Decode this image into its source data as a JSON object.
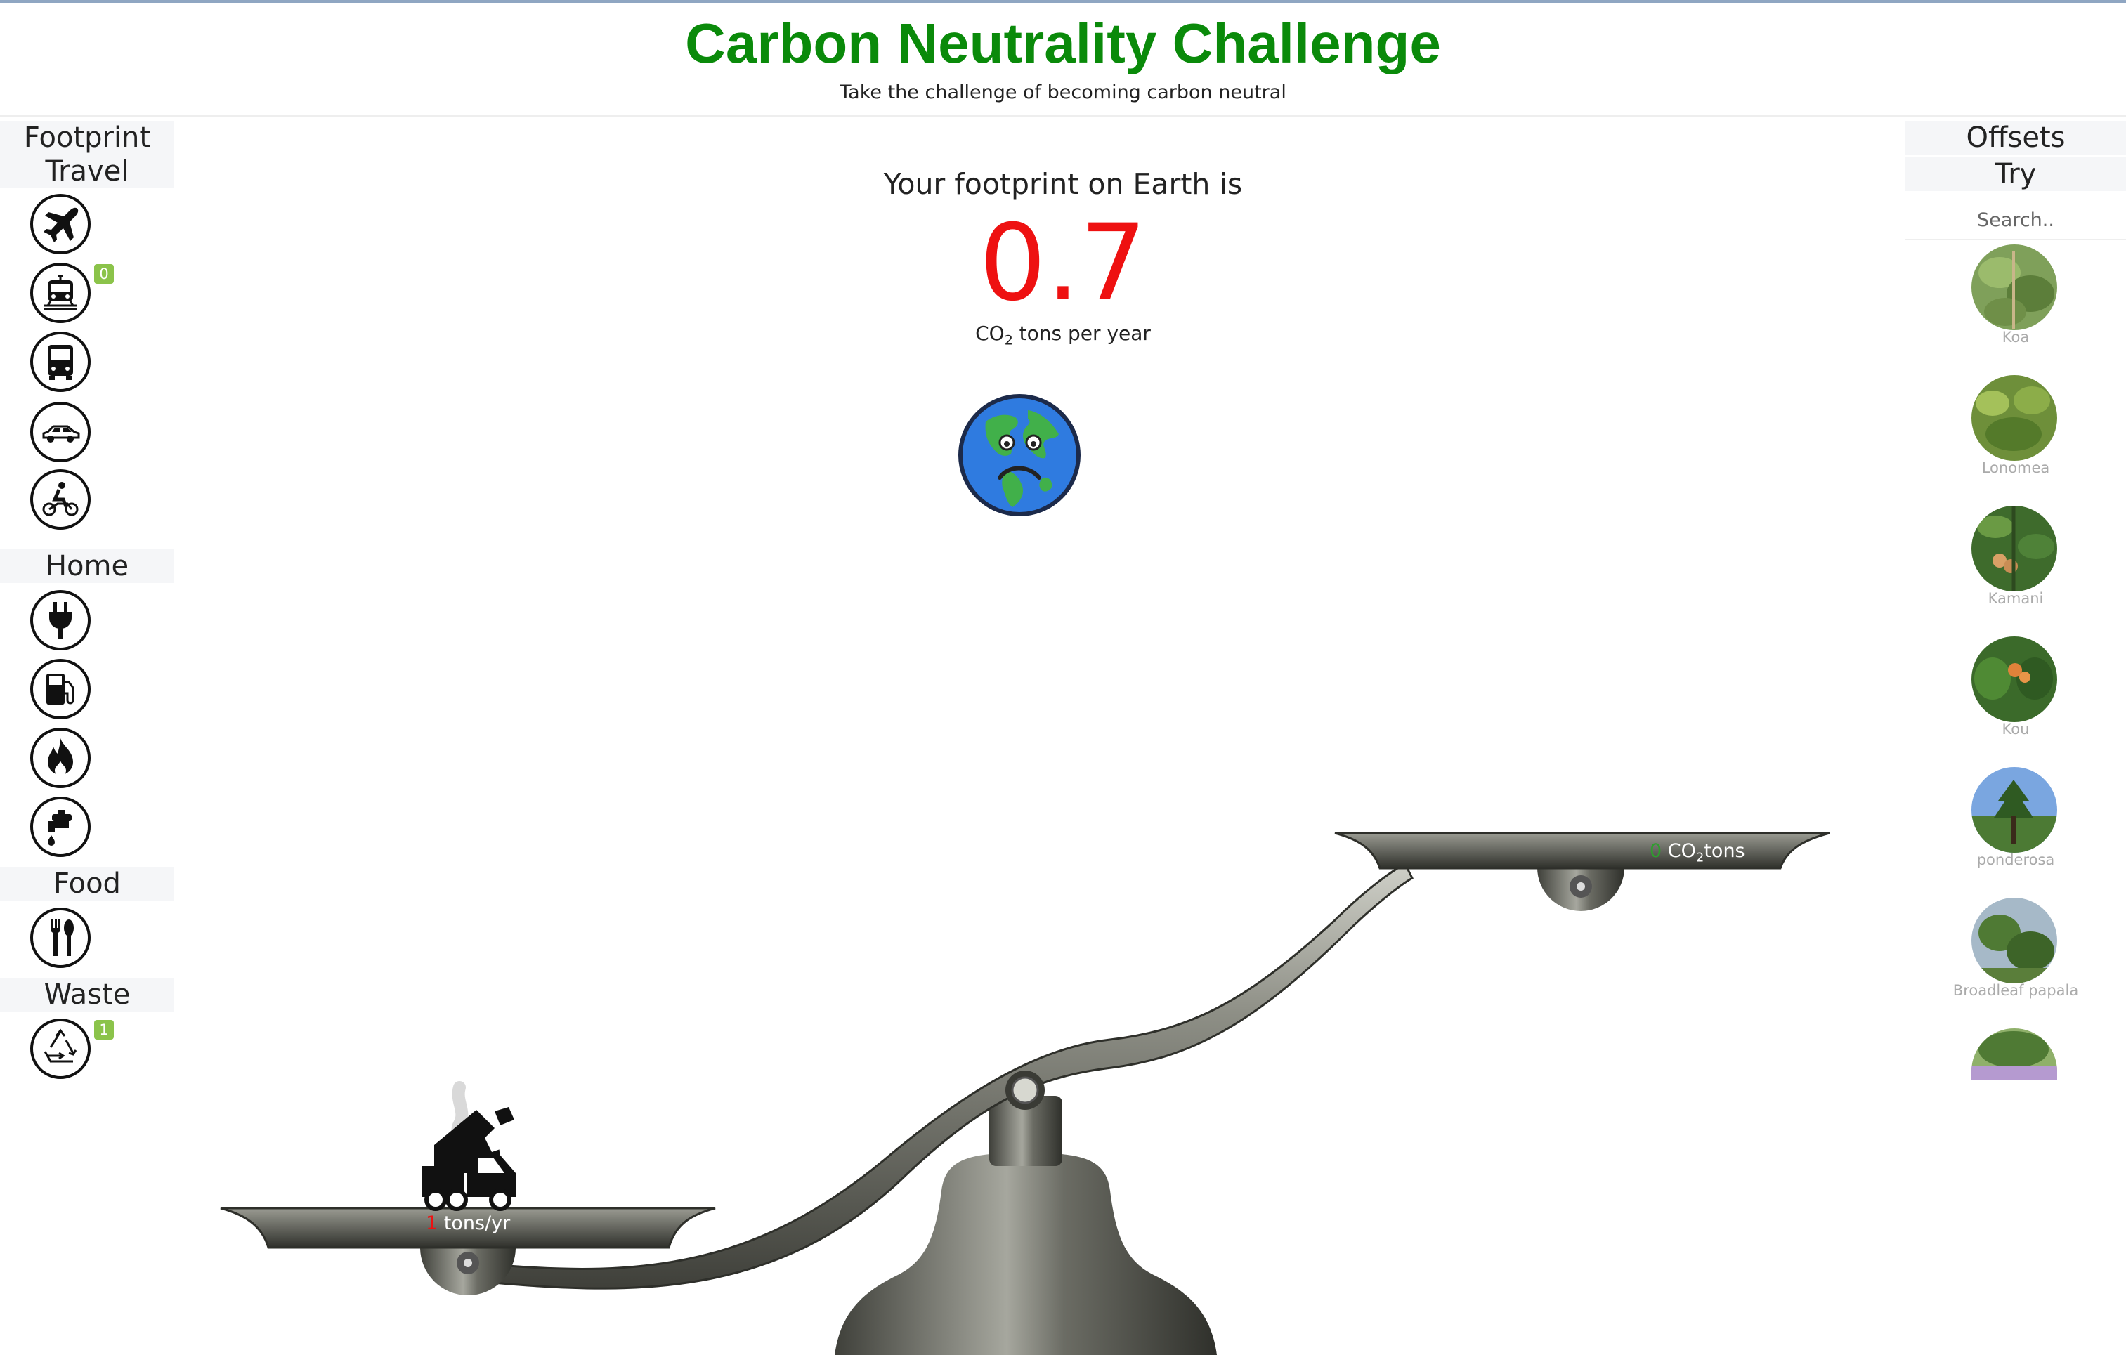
{
  "header": {
    "title": "Carbon Neutrality Challenge",
    "subtitle": "Take the challenge of becoming carbon neutral"
  },
  "sidebar": {
    "heading": "Footprint",
    "sections": [
      {
        "label": "Travel",
        "items": [
          {
            "icon": "airplane-icon",
            "badge": null
          },
          {
            "icon": "train-icon",
            "badge": "0"
          },
          {
            "icon": "bus-icon",
            "badge": null
          },
          {
            "icon": "car-icon",
            "badge": null
          },
          {
            "icon": "motorcycle-icon",
            "badge": null
          }
        ]
      },
      {
        "label": "Home",
        "items": [
          {
            "icon": "electricity-plug-icon",
            "badge": null
          },
          {
            "icon": "fuel-pump-icon",
            "badge": null
          },
          {
            "icon": "flame-icon",
            "badge": null
          },
          {
            "icon": "water-tap-icon",
            "badge": null
          }
        ]
      },
      {
        "label": "Food",
        "items": [
          {
            "icon": "fork-spoon-icon",
            "badge": null
          }
        ]
      },
      {
        "label": "Waste",
        "items": [
          {
            "icon": "recycle-icon",
            "badge": "1"
          }
        ]
      }
    ]
  },
  "main": {
    "footprint_label": "Your footprint on Earth is",
    "footprint_value": "0.7",
    "unit_co": "CO",
    "unit_sub": "2",
    "unit_rest": " tons per year",
    "earth_icon": "sad-earth-icon"
  },
  "scale": {
    "left_pan": {
      "value": "1",
      "unit": " tons/yr",
      "icon": "garbage-truck-icon"
    },
    "right_pan": {
      "value": "0",
      "unit_co": "CO",
      "unit_sub": "2",
      "unit_rest": "tons"
    }
  },
  "offsets": {
    "heading": "Offsets",
    "subheading": "Try",
    "search_placeholder": "Search..",
    "plants": [
      {
        "name": "Koa"
      },
      {
        "name": "Lonomea"
      },
      {
        "name": "Kamani"
      },
      {
        "name": "Kou"
      },
      {
        "name": "ponderosa"
      },
      {
        "name": "Broadleaf papala"
      },
      {
        "name": ""
      }
    ]
  },
  "colors": {
    "title": "#0a8a0a",
    "footprint_value": "#ee1111",
    "badge": "#8bc34a",
    "offset_value": "#2e9e2e"
  }
}
